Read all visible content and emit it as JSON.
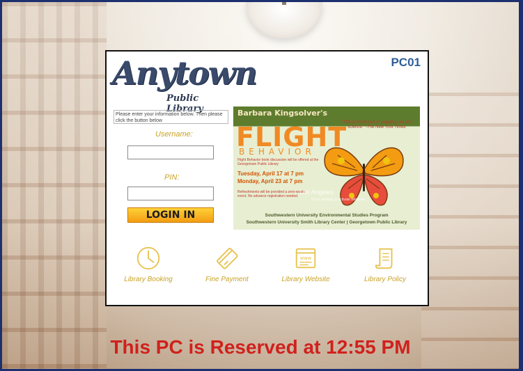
{
  "logo": {
    "name": "Anytown",
    "subtitle": "Public Library"
  },
  "pc_id": "PC01",
  "login": {
    "instructions": "Please enter your information below. Then please click the button below",
    "username_label": "Username:",
    "username_value": "",
    "pin_label": "PIN:",
    "pin_value": "",
    "button_label": "LOGIN IN"
  },
  "poster": {
    "author": "Barbara Kingsolver's",
    "title": "FLIGHT",
    "subtitle": "BEHAVIOR",
    "quote": "\"This is fiction rich in empathy, wit and science.\" -The New York Times",
    "blurb": "Flight Behavior book discussion will be offered at the Georgetown Public Library",
    "date1": "Tuesday, April 17 at 7 pm",
    "date2": "Monday, April 23 at 7 pm",
    "refreshments": "Refreshments will be provided a zero-waste event. No advance registration needed.",
    "org1": "Southwestern University Environmental Studies Program",
    "org2": "Southwestern University Smith Library Center | Georgetown Public Library",
    "watermark": "Los Angeles",
    "watermark_sub": "Go to Settings to activate Windows."
  },
  "links": [
    {
      "label": "Library Booking",
      "icon": "clock-icon"
    },
    {
      "label": "Fine Payment",
      "icon": "credit-card-icon"
    },
    {
      "label": "Library Website",
      "icon": "website-icon"
    },
    {
      "label": "Library Policy",
      "icon": "scroll-icon"
    }
  ],
  "reserved_message": "This PC is Reserved at 12:55 PM",
  "colors": {
    "accent_gold": "#c9a227",
    "pc_blue": "#2f5e9a",
    "reserved_red": "#d0211c",
    "login_orange": "#f39c12"
  }
}
